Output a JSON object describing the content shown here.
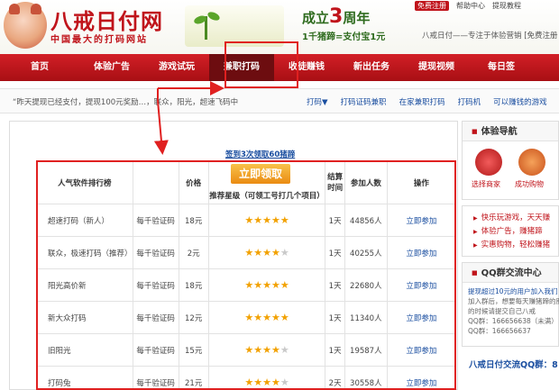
{
  "header": {
    "logo_title": "八戒日付网",
    "logo_subtitle": "中国最大的打码网站",
    "anniversary_prefix": "成立",
    "anniversary_number": "3",
    "anniversary_suffix": "周年",
    "anniversary_sub": "1千猪蹄=支付宝1元",
    "top_links": [
      "免费注册",
      "帮助中心",
      "提现教程"
    ],
    "slogan": "八戒日付——专注于体验营销  [免费注册"
  },
  "nav": {
    "items": [
      "首页",
      "体验广告",
      "游戏试玩",
      "兼职打码",
      "收徒赚钱",
      "新出任务",
      "提现视频",
      "每日签"
    ]
  },
  "subbar": {
    "scroll_text": "“昨天提现已经支付，提现100元奖励…，联众，阳光，超速飞码中",
    "links": [
      "打码▼",
      "打码证码兼职",
      "在家兼职打码",
      "打码机",
      "可以赚钱的游戏"
    ]
  },
  "promo": {
    "link_text": "签到3次领取60猪蹄",
    "claim_button": "立即领取"
  },
  "table": {
    "headers": {
      "name": "人气软件排行榜",
      "price": "价格",
      "recommend": "推荐星级（可领工号打几个项目）",
      "settle": "结算时间",
      "participants": "参加人数",
      "action": "操作"
    },
    "rows": [
      {
        "name": "超速打码（新人）",
        "unit": "每千验证码",
        "price": "18元",
        "stars": 5,
        "settle": "1天",
        "count": "44856人",
        "action": "立即参加"
      },
      {
        "name": "联众，极速打码（推荐）",
        "unit": "每千验证码",
        "price": "2元",
        "stars": 4,
        "settle": "1天",
        "count": "40255人",
        "action": "立即参加"
      },
      {
        "name": "阳光高价新",
        "unit": "每千验证码",
        "price": "18元",
        "stars": 5,
        "settle": "1天",
        "count": "22680人",
        "action": "立即参加"
      },
      {
        "name": "新大众打码",
        "unit": "每千验证码",
        "price": "12元",
        "stars": 5,
        "settle": "1天",
        "count": "11340人",
        "action": "立即参加"
      },
      {
        "name": "旧阳光",
        "unit": "每千验证码",
        "price": "15元",
        "stars": 4,
        "settle": "1天",
        "count": "19587人",
        "action": "立即参加"
      },
      {
        "name": "打码兔",
        "unit": "每千验证码",
        "price": "21元",
        "stars": 4,
        "settle": "2天",
        "count": "30558人",
        "action": "立即参加"
      }
    ]
  },
  "sidebar": {
    "guide_title": "体验导航",
    "guide_labels": [
      "选择商家",
      "成功购物"
    ],
    "links": [
      "快乐玩游戏，天天赚",
      "体验广告，赚猪蹄",
      "实惠购物，轻松赚猪"
    ],
    "qq_title": "QQ群交流中心",
    "qq_lines": [
      "提现超过10元的用户加入我们",
      "加入群后，想要每天赚猪蹄的朋友加入",
      "的时候请提交自己八戒",
      "QQ群：166656638（未满）",
      "QQ群：166656637"
    ],
    "group_title": "八戒日付交流QQ群：8"
  },
  "colors": {
    "brand_red": "#c0141b",
    "nav_red": "#d21f26",
    "nav_active": "#6d0d10",
    "link_blue": "#1a4ea0",
    "star_gold": "#f2a100",
    "annotation_red": "#e02020"
  }
}
